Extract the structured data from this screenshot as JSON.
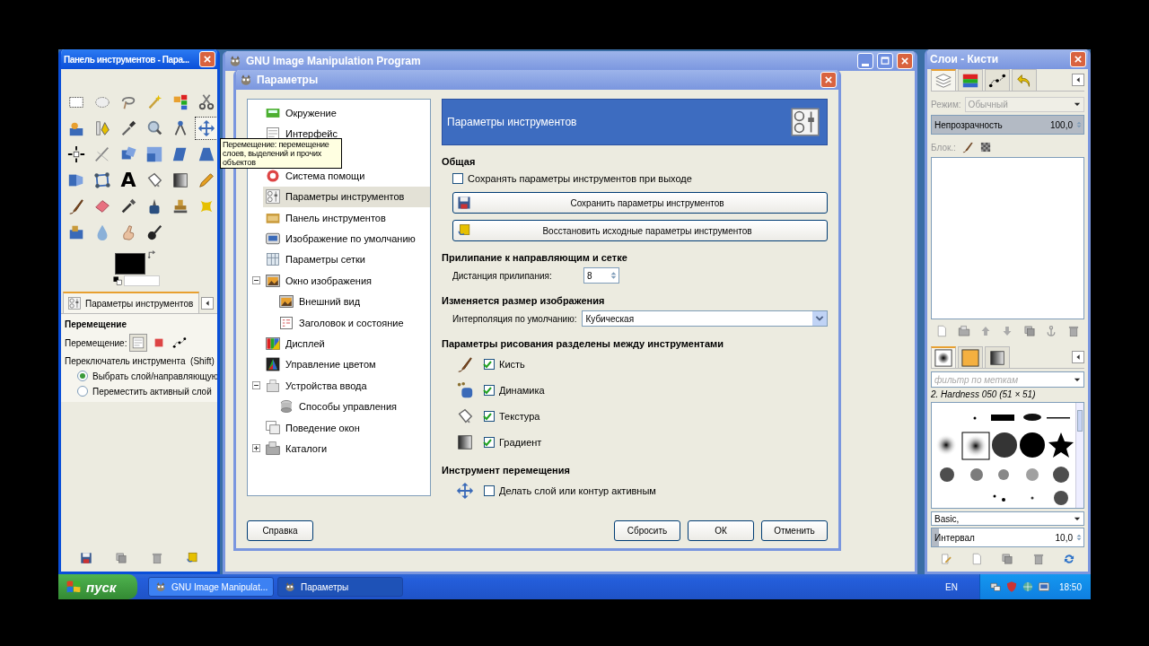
{
  "toolbox": {
    "title": "Панель инструментов - Пара...",
    "active": true,
    "tools": [
      {
        "selected": false
      },
      {
        "selected": false
      },
      {
        "selected": false
      },
      {
        "selected": false
      },
      {
        "selected": false
      },
      {
        "selected": false
      },
      {
        "selected": false
      },
      {
        "selected": false
      },
      {
        "selected": false
      },
      {
        "selected": false
      },
      {
        "selected": false
      },
      {
        "selected": true
      },
      {
        "selected": false
      },
      {
        "selected": false
      },
      {
        "selected": false
      },
      {
        "selected": false
      },
      {
        "selected": false
      },
      {
        "selected": false
      },
      {
        "selected": false
      },
      {
        "selected": false
      },
      {
        "selected": false,
        "glyph": "A"
      },
      {
        "selected": false
      },
      {
        "selected": false
      },
      {
        "selected": false
      },
      {
        "selected": false
      },
      {
        "selected": false
      },
      {
        "selected": false
      },
      {
        "selected": false
      },
      {
        "selected": false
      },
      {
        "selected": false
      },
      {
        "selected": false
      },
      {
        "selected": false
      },
      {
        "selected": false
      },
      {
        "selected": false
      }
    ],
    "options_tab": {
      "label": "Параметры инструментов",
      "selected": true
    },
    "options": {
      "heading": "Перемещение",
      "mode_label": "Перемещение:",
      "modes": [
        {
          "selected": true
        },
        {
          "selected": false
        },
        {
          "selected": false
        }
      ],
      "switch_label": "Переключатель инструмента  (Shift)",
      "radios": [
        {
          "label": "Выбрать слой/направляющую",
          "selected": true
        },
        {
          "label": "Переместить активный слой",
          "selected": false
        }
      ]
    }
  },
  "tooltip": {
    "text": "Перемещение: перемещение слоев, выделений и прочих объектов"
  },
  "main_window": {
    "title": "GNU Image Manipulation Program",
    "active": false
  },
  "preferences": {
    "title": "Параметры",
    "active": false,
    "categories": [
      {
        "label": "Окружение",
        "selected": false
      },
      {
        "label": "Интерфейс",
        "selected": false
      },
      {
        "label": "Система помощи",
        "selected": false
      },
      {
        "label": "Параметры инструментов",
        "selected": true
      },
      {
        "label": "Панель инструментов",
        "selected": false
      },
      {
        "label": "Изображение по умолчанию",
        "selected": false
      },
      {
        "label": "Параметры сетки",
        "selected": false
      },
      {
        "label": "Окно изображения",
        "selected": false,
        "expanded": true,
        "children": [
          {
            "label": "Внешний вид",
            "selected": false
          },
          {
            "label": "Заголовок и состояние",
            "selected": false
          }
        ]
      },
      {
        "label": "Дисплей",
        "selected": false
      },
      {
        "label": "Управление цветом",
        "selected": false
      },
      {
        "label": "Устройства ввода",
        "selected": false,
        "expanded": true,
        "children": [
          {
            "label": "Способы управления",
            "selected": false
          }
        ]
      },
      {
        "label": "Поведение окон",
        "selected": false
      },
      {
        "label": "Каталоги",
        "selected": false,
        "expanded": false
      }
    ],
    "header": "Параметры инструментов",
    "sections": [
      {
        "heading": "Общая",
        "items": [
          {
            "kind": "checkbox",
            "label": "Сохранять параметры инструментов при выходе",
            "checked": false
          },
          {
            "kind": "button",
            "label": "Сохранить параметры инструментов"
          },
          {
            "kind": "button",
            "label": "Восстановить исходные параметры инструментов"
          }
        ]
      },
      {
        "heading": "Прилипание к направляющим и сетке",
        "items": [
          {
            "kind": "spin",
            "label": "Дистанция прилипания:",
            "value": "8"
          }
        ]
      },
      {
        "heading": "Изменяется размер изображения",
        "items": [
          {
            "kind": "combo",
            "label": "Интерполяция по умолчанию:",
            "value": "Кубическая"
          }
        ]
      },
      {
        "heading": "Параметры рисования разделены между инструментами",
        "items": [
          {
            "kind": "checkbox",
            "label": "Кисть",
            "checked": true
          },
          {
            "kind": "checkbox",
            "label": "Динамика",
            "checked": true
          },
          {
            "kind": "checkbox",
            "label": "Текстура",
            "checked": true
          },
          {
            "kind": "checkbox",
            "label": "Градиент",
            "checked": true
          }
        ]
      },
      {
        "heading": "Инструмент перемещения",
        "items": [
          {
            "kind": "checkbox",
            "label": "Делать слой или контур активным",
            "checked": false
          }
        ]
      }
    ],
    "buttons": [
      {
        "label": "Справка"
      },
      {
        "label": "Сбросить"
      },
      {
        "label": "ОК"
      },
      {
        "label": "Отменить"
      }
    ]
  },
  "dock": {
    "title": "Слои - Кисти",
    "active": false,
    "tabs": [
      {
        "selected": true
      },
      {
        "selected": false
      },
      {
        "selected": false
      },
      {
        "selected": false
      }
    ],
    "mode": {
      "label": "Режим:",
      "value": "Обычный",
      "disabled": true
    },
    "opacity": {
      "label": "Непрозрачность",
      "reading": "100,0",
      "level": 1
    },
    "lock_label": "Блок.:",
    "brush_tabs": [
      {
        "selected": true
      },
      {
        "selected": false
      },
      {
        "selected": false
      }
    ],
    "filter_placeholder": "фильтр по меткам",
    "brush_name": "2. Hardness 050 (51 × 51)",
    "brush_set": "Basic,",
    "spacing": {
      "label": "Интервал",
      "reading": "10,0",
      "level": 0.05
    }
  },
  "taskbar": {
    "start_label": "пуск",
    "tasks": [
      {
        "label": "GNU Image Manipulat...",
        "selected": false
      },
      {
        "label": "Параметры",
        "selected": true
      }
    ],
    "language": "EN",
    "clock": "18:50"
  }
}
